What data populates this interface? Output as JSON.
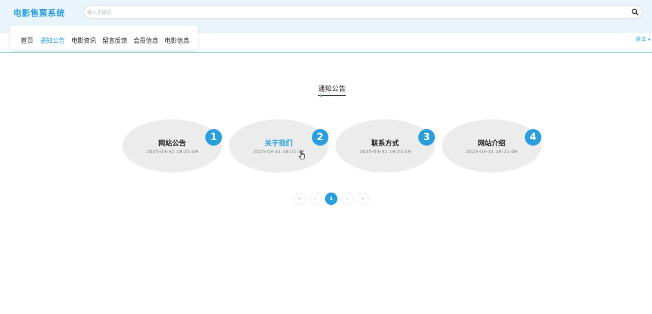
{
  "header": {
    "brand": "电影售票系统",
    "search_placeholder": "输入关键词"
  },
  "nav": {
    "items": [
      {
        "label": "首页",
        "active": false
      },
      {
        "label": "通知公告",
        "active": true
      },
      {
        "label": "电影资讯",
        "active": false
      },
      {
        "label": "留言反馈",
        "active": false
      },
      {
        "label": "会员信息",
        "active": false
      },
      {
        "label": "电影信息",
        "active": false
      }
    ],
    "user": "测试"
  },
  "section": {
    "title": "通知公告"
  },
  "notices": [
    {
      "number": "1",
      "title": "网站公告",
      "date": "2025-03-31 18:21:49"
    },
    {
      "number": "2",
      "title": "关于我们",
      "date": "2025-03-31 18:21:49"
    },
    {
      "number": "3",
      "title": "联系方式",
      "date": "2025-03-31 18:21:49"
    },
    {
      "number": "4",
      "title": "网站介绍",
      "date": "2025-03-31 18:21:49"
    }
  ],
  "pagination": {
    "first": "«",
    "prev": "‹",
    "current": "1",
    "next": "›",
    "last": "»"
  },
  "colors": {
    "accent": "#2a9fdc",
    "header_bg": "#eaf4fb",
    "card_bg": "#ececec",
    "nav_divider": "#3aa8a0"
  },
  "icons": {
    "search": "search-icon",
    "cursor": "hand-cursor-icon"
  }
}
